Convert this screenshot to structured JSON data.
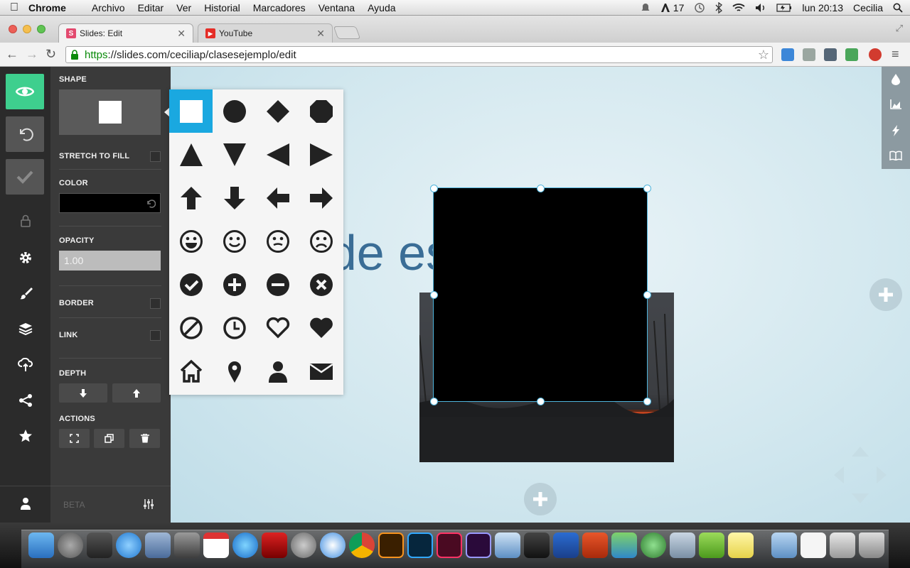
{
  "menubar": {
    "app": "Chrome",
    "items": [
      "Archivo",
      "Editar",
      "Ver",
      "Historial",
      "Marcadores",
      "Ventana",
      "Ayuda"
    ],
    "notif_count": "17",
    "clock": "lun 20:13",
    "user": "Cecilia"
  },
  "tabs": [
    {
      "title": "Slides: Edit",
      "favicon": "S",
      "active": true
    },
    {
      "title": "YouTube",
      "favicon": "▶",
      "active": false
    }
  ],
  "toolbar": {
    "url_scheme": "https",
    "url_rest": "://slides.com/ceciliap/clasesejemplo/edit"
  },
  "leftbar": {
    "items": [
      "preview-icon",
      "undo-icon",
      "check-icon",
      "lock-icon",
      "gear-icon",
      "brush-icon",
      "layers-icon",
      "cloud-upload-icon",
      "share-icon",
      "star-icon",
      "user-icon"
    ]
  },
  "panel": {
    "shape_label": "SHAPE",
    "stretch_label": "STRETCH TO FILL",
    "color_label": "COLOR",
    "color_value": "#000000",
    "opacity_label": "OPACITY",
    "opacity_value": "1.00",
    "border_label": "BORDER",
    "link_label": "LINK",
    "depth_label": "DEPTH",
    "actions_label": "ACTIONS",
    "beta_label": "BETA"
  },
  "picker": {
    "shapes": [
      "square",
      "circle",
      "diamond",
      "octagon",
      "triangle-up",
      "triangle-down",
      "triangle-left",
      "triangle-right",
      "arrow-up",
      "arrow-down",
      "arrow-left",
      "arrow-right",
      "smiley-happy",
      "smiley",
      "smiley-meh",
      "smiley-sad",
      "check-circle",
      "plus-circle",
      "minus-circle",
      "x-circle",
      "ban",
      "clock",
      "heart-outline",
      "heart",
      "home",
      "pin",
      "person",
      "envelope"
    ],
    "selected": "square"
  },
  "canvas": {
    "text": "ble de escribir"
  },
  "colors": {
    "accent_green": "#3ecf8e",
    "selection_blue": "#1aa8e0",
    "canvas_text": "#3a6d96"
  }
}
